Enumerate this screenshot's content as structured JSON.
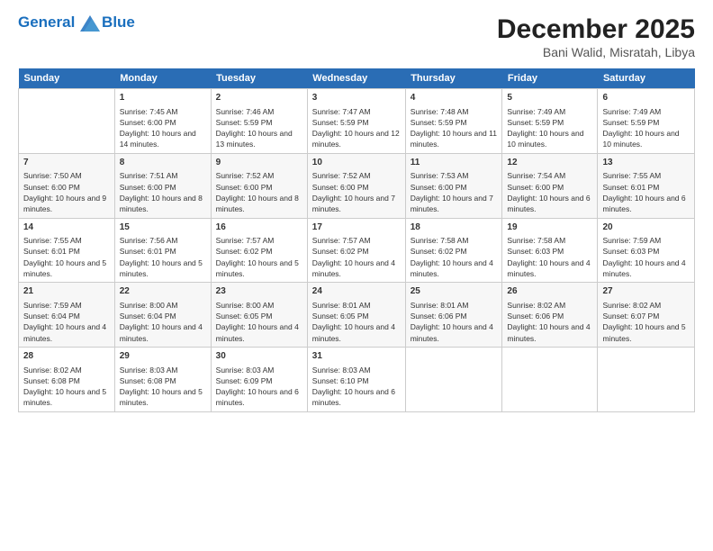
{
  "header": {
    "logo_line1": "General",
    "logo_line2": "Blue",
    "month": "December 2025",
    "location": "Bani Walid, Misratah, Libya"
  },
  "days_of_week": [
    "Sunday",
    "Monday",
    "Tuesday",
    "Wednesday",
    "Thursday",
    "Friday",
    "Saturday"
  ],
  "weeks": [
    [
      {
        "day": "",
        "sunrise": "",
        "sunset": "",
        "daylight": ""
      },
      {
        "day": "1",
        "sunrise": "7:45 AM",
        "sunset": "6:00 PM",
        "daylight": "10 hours and 14 minutes."
      },
      {
        "day": "2",
        "sunrise": "7:46 AM",
        "sunset": "5:59 PM",
        "daylight": "10 hours and 13 minutes."
      },
      {
        "day": "3",
        "sunrise": "7:47 AM",
        "sunset": "5:59 PM",
        "daylight": "10 hours and 12 minutes."
      },
      {
        "day": "4",
        "sunrise": "7:48 AM",
        "sunset": "5:59 PM",
        "daylight": "10 hours and 11 minutes."
      },
      {
        "day": "5",
        "sunrise": "7:49 AM",
        "sunset": "5:59 PM",
        "daylight": "10 hours and 10 minutes."
      },
      {
        "day": "6",
        "sunrise": "7:49 AM",
        "sunset": "5:59 PM",
        "daylight": "10 hours and 10 minutes."
      }
    ],
    [
      {
        "day": "7",
        "sunrise": "7:50 AM",
        "sunset": "6:00 PM",
        "daylight": "10 hours and 9 minutes."
      },
      {
        "day": "8",
        "sunrise": "7:51 AM",
        "sunset": "6:00 PM",
        "daylight": "10 hours and 8 minutes."
      },
      {
        "day": "9",
        "sunrise": "7:52 AM",
        "sunset": "6:00 PM",
        "daylight": "10 hours and 8 minutes."
      },
      {
        "day": "10",
        "sunrise": "7:52 AM",
        "sunset": "6:00 PM",
        "daylight": "10 hours and 7 minutes."
      },
      {
        "day": "11",
        "sunrise": "7:53 AM",
        "sunset": "6:00 PM",
        "daylight": "10 hours and 7 minutes."
      },
      {
        "day": "12",
        "sunrise": "7:54 AM",
        "sunset": "6:00 PM",
        "daylight": "10 hours and 6 minutes."
      },
      {
        "day": "13",
        "sunrise": "7:55 AM",
        "sunset": "6:01 PM",
        "daylight": "10 hours and 6 minutes."
      }
    ],
    [
      {
        "day": "14",
        "sunrise": "7:55 AM",
        "sunset": "6:01 PM",
        "daylight": "10 hours and 5 minutes."
      },
      {
        "day": "15",
        "sunrise": "7:56 AM",
        "sunset": "6:01 PM",
        "daylight": "10 hours and 5 minutes."
      },
      {
        "day": "16",
        "sunrise": "7:57 AM",
        "sunset": "6:02 PM",
        "daylight": "10 hours and 5 minutes."
      },
      {
        "day": "17",
        "sunrise": "7:57 AM",
        "sunset": "6:02 PM",
        "daylight": "10 hours and 4 minutes."
      },
      {
        "day": "18",
        "sunrise": "7:58 AM",
        "sunset": "6:02 PM",
        "daylight": "10 hours and 4 minutes."
      },
      {
        "day": "19",
        "sunrise": "7:58 AM",
        "sunset": "6:03 PM",
        "daylight": "10 hours and 4 minutes."
      },
      {
        "day": "20",
        "sunrise": "7:59 AM",
        "sunset": "6:03 PM",
        "daylight": "10 hours and 4 minutes."
      }
    ],
    [
      {
        "day": "21",
        "sunrise": "7:59 AM",
        "sunset": "6:04 PM",
        "daylight": "10 hours and 4 minutes."
      },
      {
        "day": "22",
        "sunrise": "8:00 AM",
        "sunset": "6:04 PM",
        "daylight": "10 hours and 4 minutes."
      },
      {
        "day": "23",
        "sunrise": "8:00 AM",
        "sunset": "6:05 PM",
        "daylight": "10 hours and 4 minutes."
      },
      {
        "day": "24",
        "sunrise": "8:01 AM",
        "sunset": "6:05 PM",
        "daylight": "10 hours and 4 minutes."
      },
      {
        "day": "25",
        "sunrise": "8:01 AM",
        "sunset": "6:06 PM",
        "daylight": "10 hours and 4 minutes."
      },
      {
        "day": "26",
        "sunrise": "8:02 AM",
        "sunset": "6:06 PM",
        "daylight": "10 hours and 4 minutes."
      },
      {
        "day": "27",
        "sunrise": "8:02 AM",
        "sunset": "6:07 PM",
        "daylight": "10 hours and 5 minutes."
      }
    ],
    [
      {
        "day": "28",
        "sunrise": "8:02 AM",
        "sunset": "6:08 PM",
        "daylight": "10 hours and 5 minutes."
      },
      {
        "day": "29",
        "sunrise": "8:03 AM",
        "sunset": "6:08 PM",
        "daylight": "10 hours and 5 minutes."
      },
      {
        "day": "30",
        "sunrise": "8:03 AM",
        "sunset": "6:09 PM",
        "daylight": "10 hours and 6 minutes."
      },
      {
        "day": "31",
        "sunrise": "8:03 AM",
        "sunset": "6:10 PM",
        "daylight": "10 hours and 6 minutes."
      },
      {
        "day": "",
        "sunrise": "",
        "sunset": "",
        "daylight": ""
      },
      {
        "day": "",
        "sunrise": "",
        "sunset": "",
        "daylight": ""
      },
      {
        "day": "",
        "sunrise": "",
        "sunset": "",
        "daylight": ""
      }
    ]
  ]
}
